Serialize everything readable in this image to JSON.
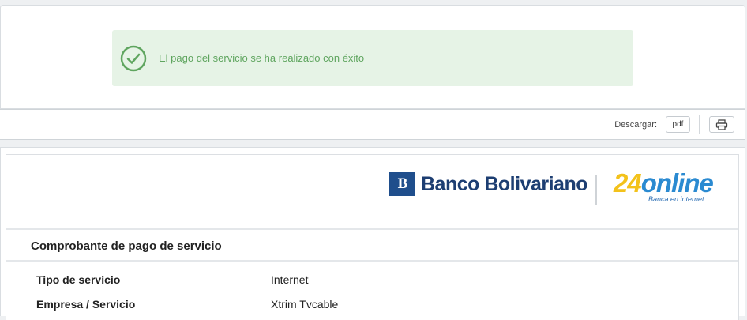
{
  "alert": {
    "message": "El pago del servicio se ha realizado con éxito",
    "icon": "check-circle-icon",
    "color": "#5fa55f",
    "background": "#e6f3e6"
  },
  "toolbar": {
    "download_label": "Descargar:",
    "pdf_label": "pdf",
    "print_icon": "printer-icon"
  },
  "logos": {
    "bank_mark": "B",
    "bank_name": "Banco Bolivariano",
    "online_number": "24",
    "online_word": "online",
    "online_tagline": "Banca en internet"
  },
  "receipt": {
    "title": "Comprobante de pago de servicio",
    "rows": [
      {
        "label": "Tipo de servicio",
        "value": "Internet"
      },
      {
        "label": "Empresa / Servicio",
        "value": "Xtrim Tvcable"
      }
    ]
  }
}
